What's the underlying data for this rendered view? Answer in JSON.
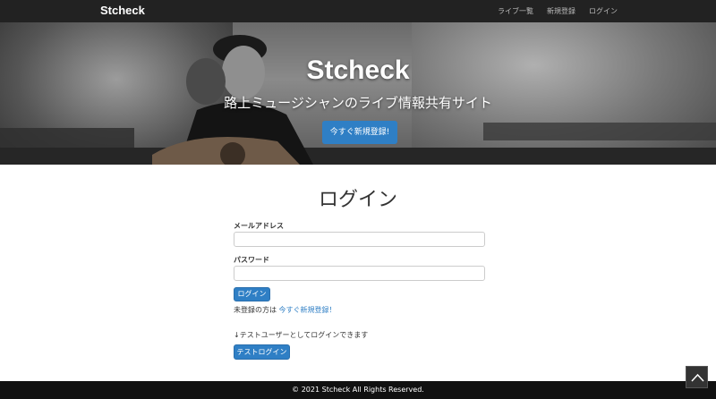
{
  "navbar": {
    "brand": "Stcheck",
    "links": [
      "ライブ一覧",
      "新規登録",
      "ログイン"
    ]
  },
  "hero": {
    "title": "Stcheck",
    "subtitle": "路上ミュージシャンのライブ情報共有サイト",
    "cta_label": "今すぐ新規登録!"
  },
  "login": {
    "title": "ログイン",
    "email_label": "メールアドレス",
    "email_value": "",
    "password_label": "パスワード",
    "password_value": "",
    "submit_label": "ログイン",
    "signup_prefix": "未登録の方は",
    "signup_link": "今すぐ新規登録！",
    "test_note": "↓テストユーザーとしてログインできます",
    "test_login_label": "テストログイン"
  },
  "footer": {
    "copyright": "© 2021 Stcheck All Rights Reserved."
  },
  "icons": {
    "scroll_top": "chevron-up-icon"
  },
  "colors": {
    "accent": "#2f7fc5",
    "navbar": "#222222",
    "footer": "#111111"
  }
}
